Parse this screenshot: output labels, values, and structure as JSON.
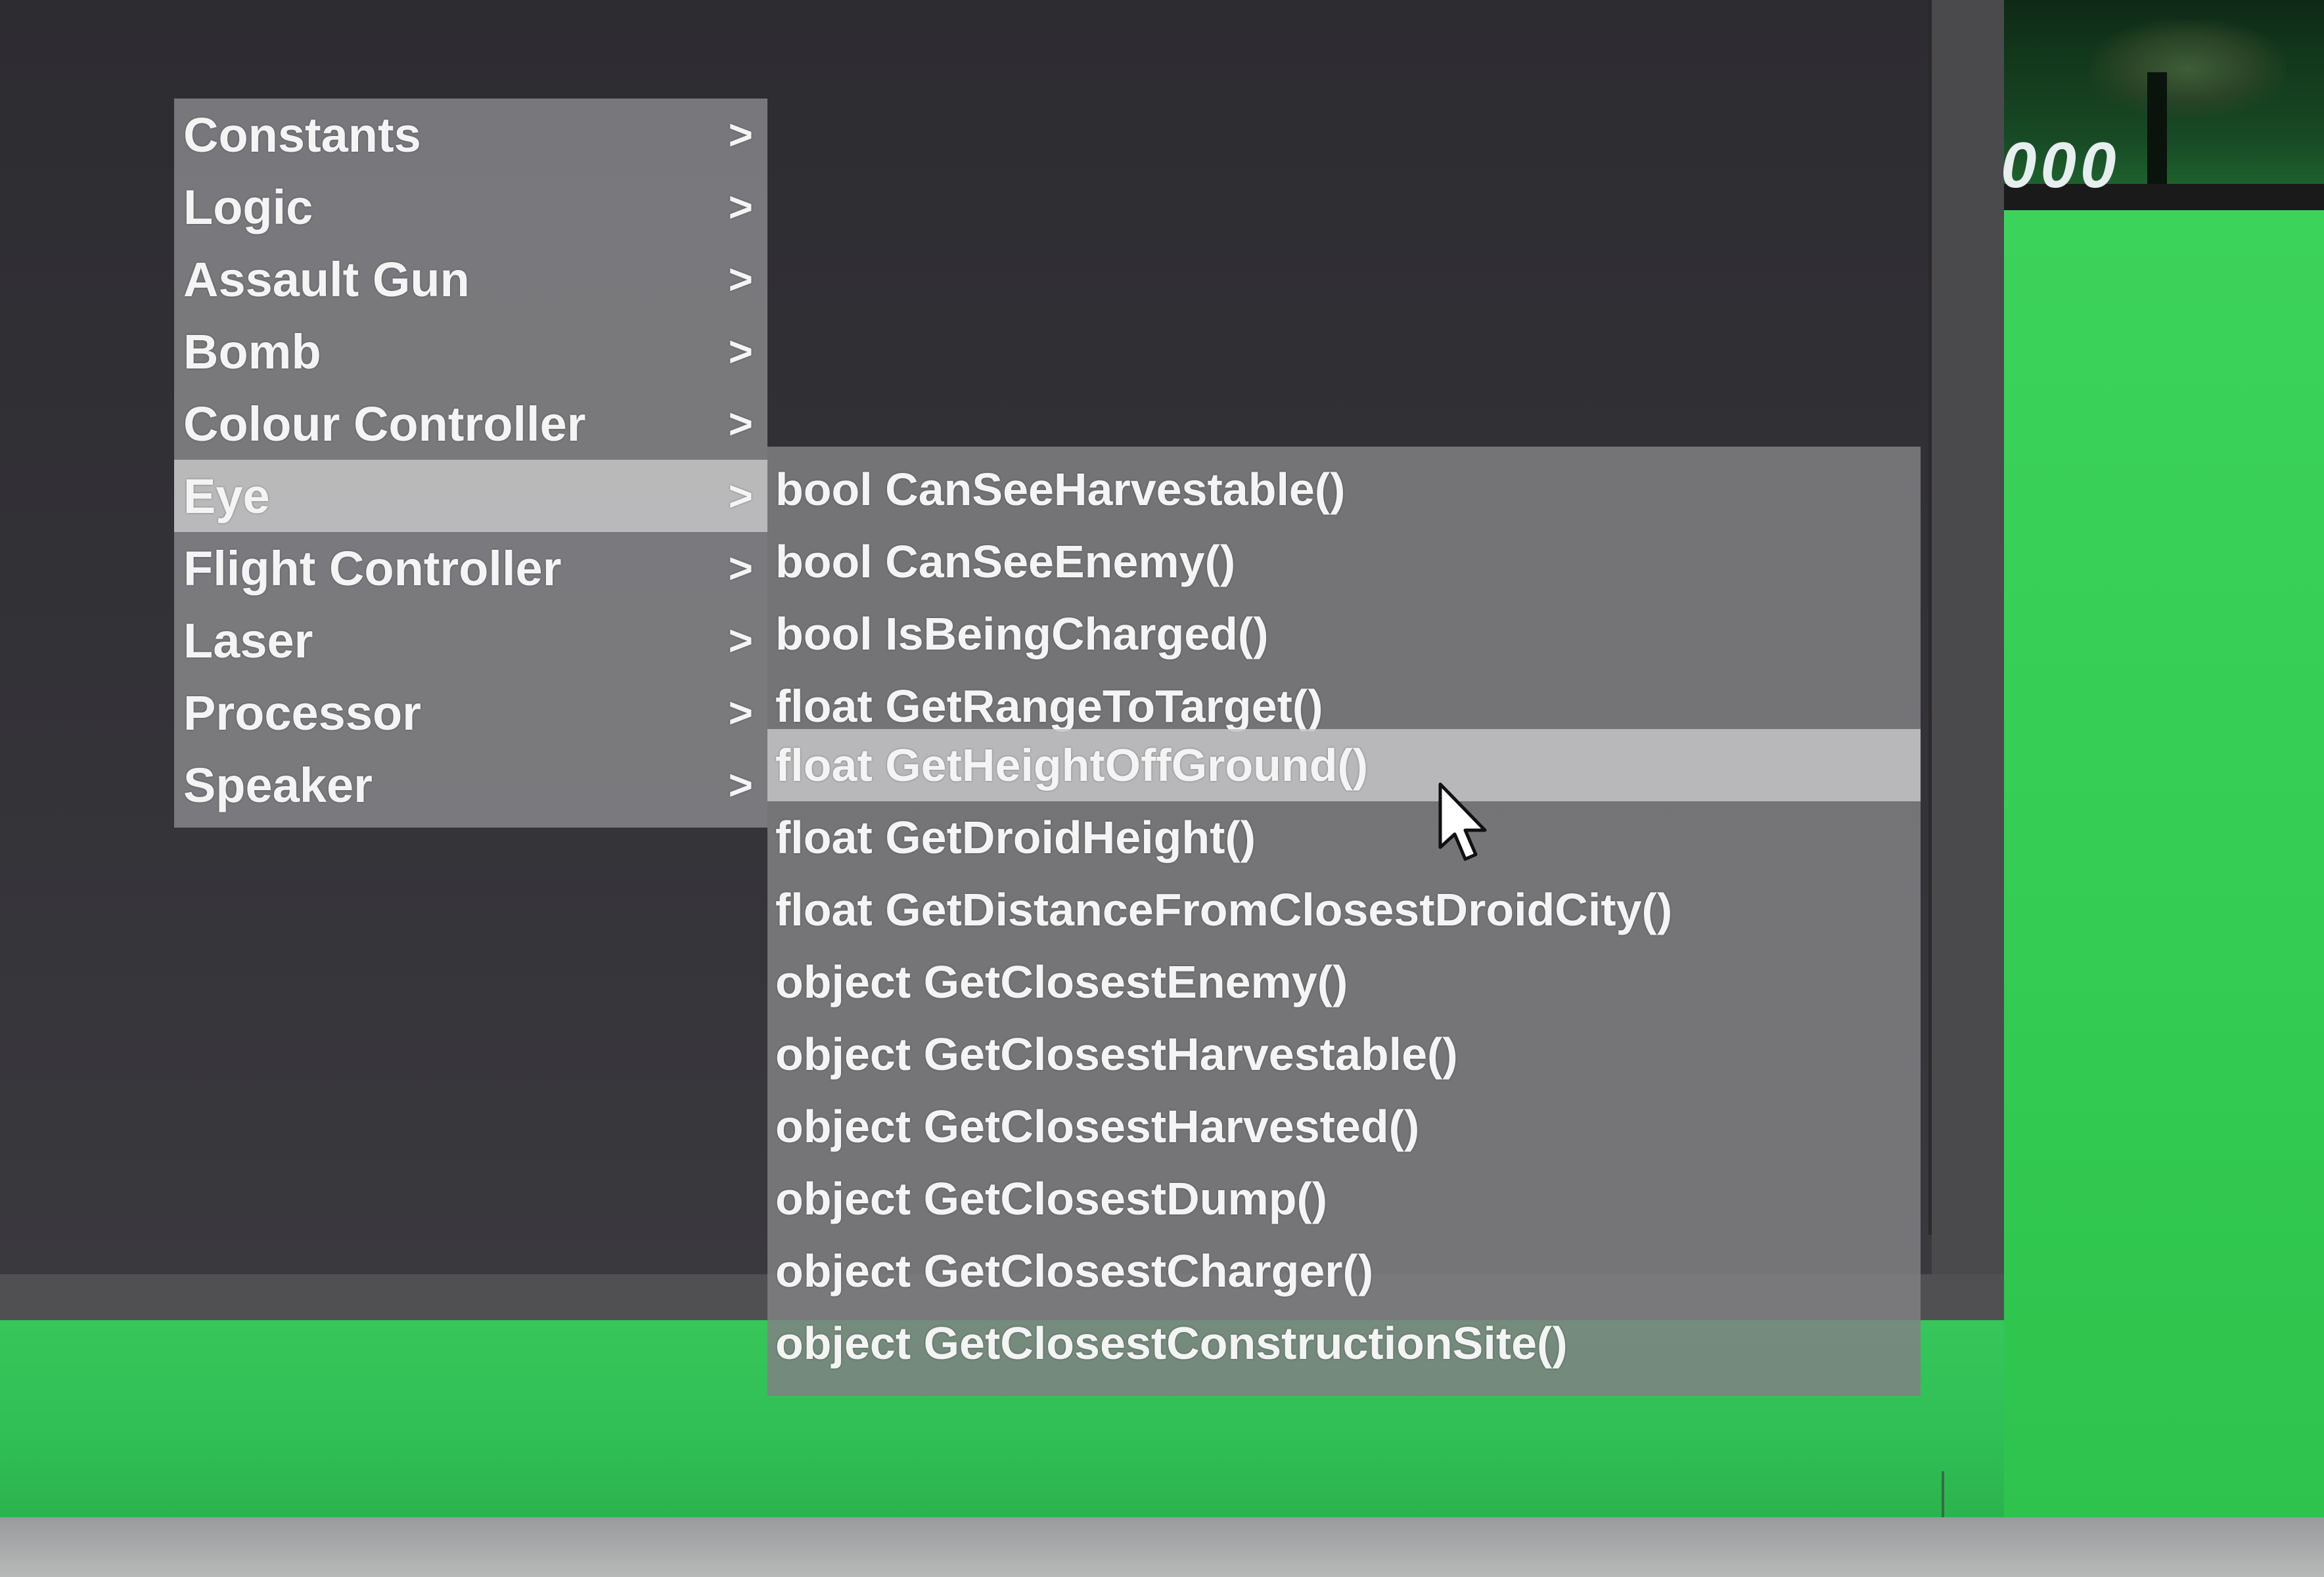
{
  "game": {
    "score_text": "000"
  },
  "main_menu": {
    "items": [
      {
        "label": "Constants",
        "arrow": ">",
        "active": false
      },
      {
        "label": "Logic",
        "arrow": ">",
        "active": false
      },
      {
        "label": "Assault Gun",
        "arrow": ">",
        "active": false
      },
      {
        "label": "Bomb",
        "arrow": ">",
        "active": false
      },
      {
        "label": "Colour Controller",
        "arrow": ">",
        "active": false
      },
      {
        "label": "Eye",
        "arrow": ">",
        "active": true
      },
      {
        "label": "Flight Controller",
        "arrow": ">",
        "active": false
      },
      {
        "label": "Laser",
        "arrow": ">",
        "active": false
      },
      {
        "label": "Processor",
        "arrow": ">",
        "active": false
      },
      {
        "label": "Speaker",
        "arrow": ">",
        "active": false
      }
    ]
  },
  "eye_submenu": {
    "items": [
      {
        "label": "bool CanSeeHarvestable()",
        "hovered": false
      },
      {
        "label": "bool CanSeeEnemy()",
        "hovered": false
      },
      {
        "label": "bool IsBeingCharged()",
        "hovered": false
      },
      {
        "label": "float GetRangeToTarget()",
        "hovered": false
      },
      {
        "label": "float GetHeightOffGround()",
        "hovered": true
      },
      {
        "label": "float GetDroidHeight()",
        "hovered": false
      },
      {
        "label": "float GetDistanceFromClosestDroidCity()",
        "hovered": false
      },
      {
        "label": "object GetClosestEnemy()",
        "hovered": false
      },
      {
        "label": "object GetClosestHarvestable()",
        "hovered": false
      },
      {
        "label": "object GetClosestHarvested()",
        "hovered": false
      },
      {
        "label": "object GetClosestDump()",
        "hovered": false
      },
      {
        "label": "object GetClosestCharger()",
        "hovered": false
      },
      {
        "label": "object GetClosestConstructionSite()",
        "hovered": false
      }
    ]
  },
  "colors": {
    "editor_background": "#2c2b30",
    "menu_highlight": "#c4c4c6",
    "game_green": "#34cc52"
  },
  "icons": {
    "cursor": "mouse-pointer-icon"
  }
}
